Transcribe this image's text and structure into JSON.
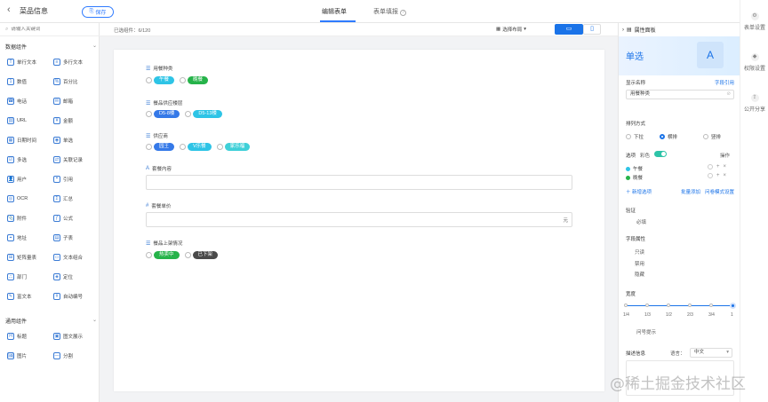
{
  "topbar": {
    "title": "菜品信息",
    "save_label": "保存",
    "tabs": [
      {
        "label": "编辑表单",
        "active": true
      },
      {
        "label": "表单填报",
        "active": false
      }
    ]
  },
  "left": {
    "search_placeholder": "请输入关键词",
    "sections": [
      {
        "title": "数据组件",
        "items": [
          {
            "label": "单行文本",
            "icon": "T"
          },
          {
            "label": "多行文本",
            "icon": "≡"
          },
          {
            "label": "数值",
            "icon": "1"
          },
          {
            "label": "百分比",
            "icon": "%"
          },
          {
            "label": "电话",
            "icon": "☎"
          },
          {
            "label": "邮箱",
            "icon": "✉"
          },
          {
            "label": "URL",
            "icon": "⛓"
          },
          {
            "label": "金额",
            "icon": "¥"
          },
          {
            "label": "日期时间",
            "icon": "▦"
          },
          {
            "label": "单选",
            "icon": "◉"
          },
          {
            "label": "多选",
            "icon": "☑"
          },
          {
            "label": "关联记录",
            "icon": "⇄"
          },
          {
            "label": "用户",
            "icon": "👤"
          },
          {
            "label": "引用",
            "icon": "❝"
          },
          {
            "label": "OCR",
            "icon": "◎"
          },
          {
            "label": "汇总",
            "icon": "Σ"
          },
          {
            "label": "附件",
            "icon": "📎"
          },
          {
            "label": "公式",
            "icon": "ƒ"
          },
          {
            "label": "地址",
            "icon": "⌖"
          },
          {
            "label": "子表",
            "icon": "▤"
          },
          {
            "label": "矩阵量表",
            "icon": "⊞"
          },
          {
            "label": "文本组合",
            "icon": "▭"
          },
          {
            "label": "部门",
            "icon": "⛬"
          },
          {
            "label": "定位",
            "icon": "◈"
          },
          {
            "label": "富文本",
            "icon": "✎"
          },
          {
            "label": "自动编号",
            "icon": "#"
          }
        ]
      },
      {
        "title": "通用组件",
        "items": [
          {
            "label": "标题",
            "icon": "H"
          },
          {
            "label": "图文展示",
            "icon": "▣"
          },
          {
            "label": "图片",
            "icon": "🖼"
          },
          {
            "label": "分割",
            "icon": "—"
          }
        ]
      }
    ]
  },
  "toolbar": {
    "count_label": "已选组件：6/120",
    "layout_label": "选择布局",
    "device_pc_icon": "monitor-icon",
    "device_mobile_icon": "mobile-icon"
  },
  "canvas": {
    "fields": [
      {
        "label": "用餐种类",
        "type": "radio",
        "options": [
          {
            "label": "午餐",
            "color": "#2ec4e6"
          },
          {
            "label": "晚餐",
            "color": "#26b34a"
          }
        ]
      },
      {
        "label": "餐品供应楼层",
        "type": "radio",
        "options": [
          {
            "label": "D5-8楼",
            "color": "#3579e8"
          },
          {
            "label": "D5-13楼",
            "color": "#2ec4e6"
          }
        ]
      },
      {
        "label": "供应商",
        "type": "radio",
        "options": [
          {
            "label": "园王",
            "color": "#3579e8"
          },
          {
            "label": "V乐餐",
            "color": "#2ec4e6"
          },
          {
            "label": "家乐福",
            "color": "#3fd0d8"
          }
        ]
      },
      {
        "label": "套餐内容",
        "type": "text"
      },
      {
        "label": "套餐单价",
        "type": "number",
        "suffix": "元"
      },
      {
        "label": "餐品上架情况",
        "type": "radio",
        "options": [
          {
            "label": "热卖中",
            "color": "#26b34a"
          },
          {
            "label": "已下架",
            "color": "#4a4a4a"
          }
        ]
      }
    ]
  },
  "prop": {
    "header": "属性面板",
    "banner_title": "单选",
    "display_name_label": "显示名称",
    "field_ref_link": "字段引用",
    "display_name_value": "用餐种类",
    "arrange_label": "排列方式",
    "arrange_options": [
      {
        "label": "下拉",
        "selected": false
      },
      {
        "label": "横排",
        "selected": true
      },
      {
        "label": "竖排",
        "selected": false
      }
    ],
    "options_label": "选项",
    "color_label": "彩色",
    "ops_label": "操作",
    "options": [
      {
        "label": "午餐",
        "color": "#2ec4e6"
      },
      {
        "label": "晚餐",
        "color": "#26b34a"
      }
    ],
    "add_option": "新增选项",
    "batch_add": "批量添加",
    "qa_mode": "问卷模式设置",
    "validate_label": "验证",
    "required_label": "必填",
    "field_attr_label": "字段属性",
    "attr_items": [
      "只读",
      "禁用",
      "隐藏"
    ],
    "width_label": "宽度",
    "width_value": "1",
    "width_ticks": [
      "1/4",
      "1/3",
      "1/2",
      "2/3",
      "3/4",
      "1"
    ],
    "hint_label": "问号提示",
    "desc_label": "描述信息",
    "lang_label": "语言：",
    "lang_value": "中文"
  },
  "farright": {
    "items": [
      {
        "label": "表单设置",
        "icon": "gear-icon"
      },
      {
        "label": "权限设置",
        "icon": "shield-icon"
      },
      {
        "label": "公开分享",
        "icon": "share-icon"
      }
    ]
  },
  "watermark": "@稀土掘金技术社区"
}
